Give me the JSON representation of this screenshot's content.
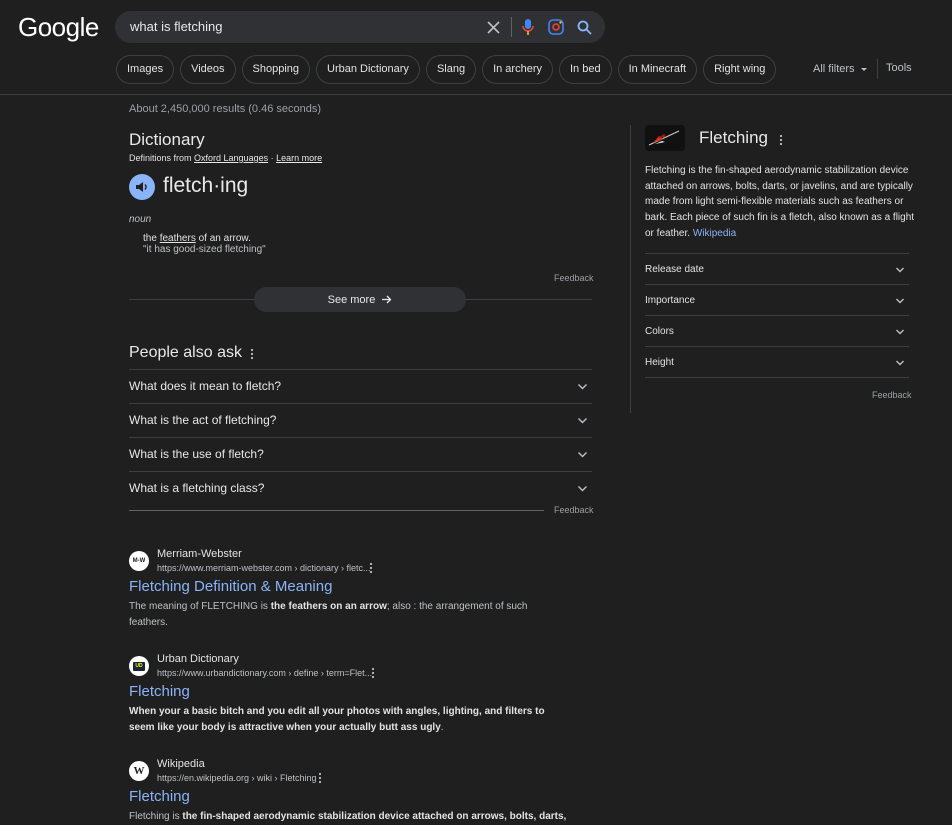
{
  "header": {
    "logo": "Google",
    "search_query": "what is fletching",
    "chips": [
      "Images",
      "Videos",
      "Shopping",
      "Urban Dictionary",
      "Slang",
      "In archery",
      "In bed",
      "In Minecraft",
      "Right wing"
    ],
    "all_filters": "All filters",
    "tools": "Tools"
  },
  "stats": "About 2,450,000 results (0.46 seconds)",
  "dictionary": {
    "title": "Dictionary",
    "source_prefix": "Definitions from ",
    "source_name": "Oxford Languages",
    "source_sep": " · ",
    "learn_more": "Learn more",
    "word": "fletch·ing",
    "pos": "noun",
    "def_prefix": "the ",
    "def_link": "feathers",
    "def_suffix": " of an arrow.",
    "example": "\"it has good-sized fletching\"",
    "feedback": "Feedback",
    "see_more": "See more"
  },
  "paa": {
    "title": "People also ask",
    "questions": [
      "What does it mean to fletch?",
      "What is the act of fletching?",
      "What is the use of fletch?",
      "What is a fletching class?"
    ],
    "feedback": "Feedback"
  },
  "results": [
    {
      "site": "Merriam-Webster",
      "url": "https://www.merriam-webster.com › dictionary › fletc...",
      "favicon": "M-W",
      "title": "Fletching Definition & Meaning",
      "snippet_1": "The meaning of FLETCHING is ",
      "snippet_bold": "the feathers on an arrow",
      "snippet_2": "; also : the arrangement of such feathers."
    },
    {
      "site": "Urban Dictionary",
      "url": "https://www.urbandictionary.com › define › term=Flet...",
      "favicon": "UD",
      "title": "Fletching",
      "snippet_1": "",
      "snippet_bold": "When your a basic bitch and you edit all your photos with angles, lighting, and filters to seem like your body is attractive when your actually butt ass ugly",
      "snippet_2": "."
    },
    {
      "site": "Wikipedia",
      "url": "https://en.wikipedia.org › wiki › Fletching",
      "favicon": "W",
      "title": "Fletching",
      "snippet_1": "Fletching is ",
      "snippet_bold": "the fin-shaped aerodynamic stabilization device attached on arrows, bolts, darts, or",
      "snippet_2": ""
    }
  ],
  "knowledge_panel": {
    "title": "Fletching",
    "desc": "Fletching is the fin-shaped aerodynamic stabilization device attached on arrows, bolts, darts, or javelins, and are typically made from light semi-flexible materials such as feathers or bark. Each piece of such fin is a fletch, also known as a flight or feather. ",
    "desc_link": "Wikipedia",
    "rows": [
      "Release date",
      "Importance",
      "Colors",
      "Height"
    ],
    "feedback": "Feedback"
  },
  "colors": {
    "background": "#1f1f1f",
    "link": "#8ab4f8",
    "searchbox": "#303134"
  }
}
